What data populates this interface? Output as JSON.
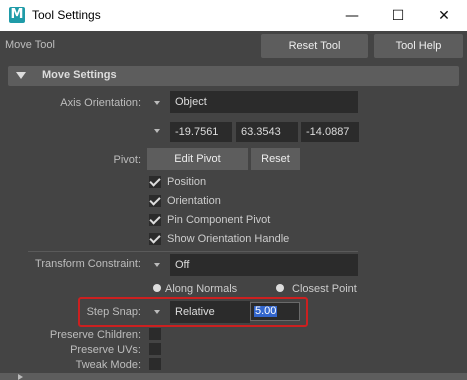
{
  "window": {
    "app_icon_letter": "M",
    "title": "Tool Settings",
    "minimize_glyph": "—",
    "maximize_glyph": "☐",
    "close_glyph": "✕"
  },
  "toolbar": {
    "tool_name": "Move Tool",
    "reset_label": "Reset Tool",
    "help_label": "Tool Help"
  },
  "section": {
    "title": "Move Settings",
    "expanded": true
  },
  "axis_orientation": {
    "label": "Axis Orientation:",
    "value": "Object",
    "x": "-19.7561",
    "y": "63.3543",
    "z": "-14.0887"
  },
  "pivot": {
    "label": "Pivot:",
    "edit_label": "Edit Pivot",
    "reset_label": "Reset",
    "options": [
      {
        "label": "Position",
        "checked": true
      },
      {
        "label": "Orientation",
        "checked": true
      },
      {
        "label": "Pin Component Pivot",
        "checked": true
      },
      {
        "label": "Show Orientation Handle",
        "checked": true
      }
    ]
  },
  "transform_constraint": {
    "label": "Transform Constraint:",
    "value": "Off",
    "radio_along_normals": "Along Normals",
    "radio_closest_point": "Closest Point",
    "selected": "Along Normals"
  },
  "step_snap": {
    "label": "Step Snap:",
    "mode": "Relative",
    "value": "5.00"
  },
  "preserve": {
    "children_label": "Preserve Children:",
    "children_checked": false,
    "uvs_label": "Preserve UVs:",
    "uvs_checked": false,
    "tweak_label": "Tweak Mode:",
    "tweak_checked": false
  },
  "colors": {
    "panel_bg": "#444444",
    "button_bg": "#5d5d5d",
    "field_bg": "#2b2b2b",
    "highlight_border": "#cc2020",
    "selection": "#3366cc"
  }
}
